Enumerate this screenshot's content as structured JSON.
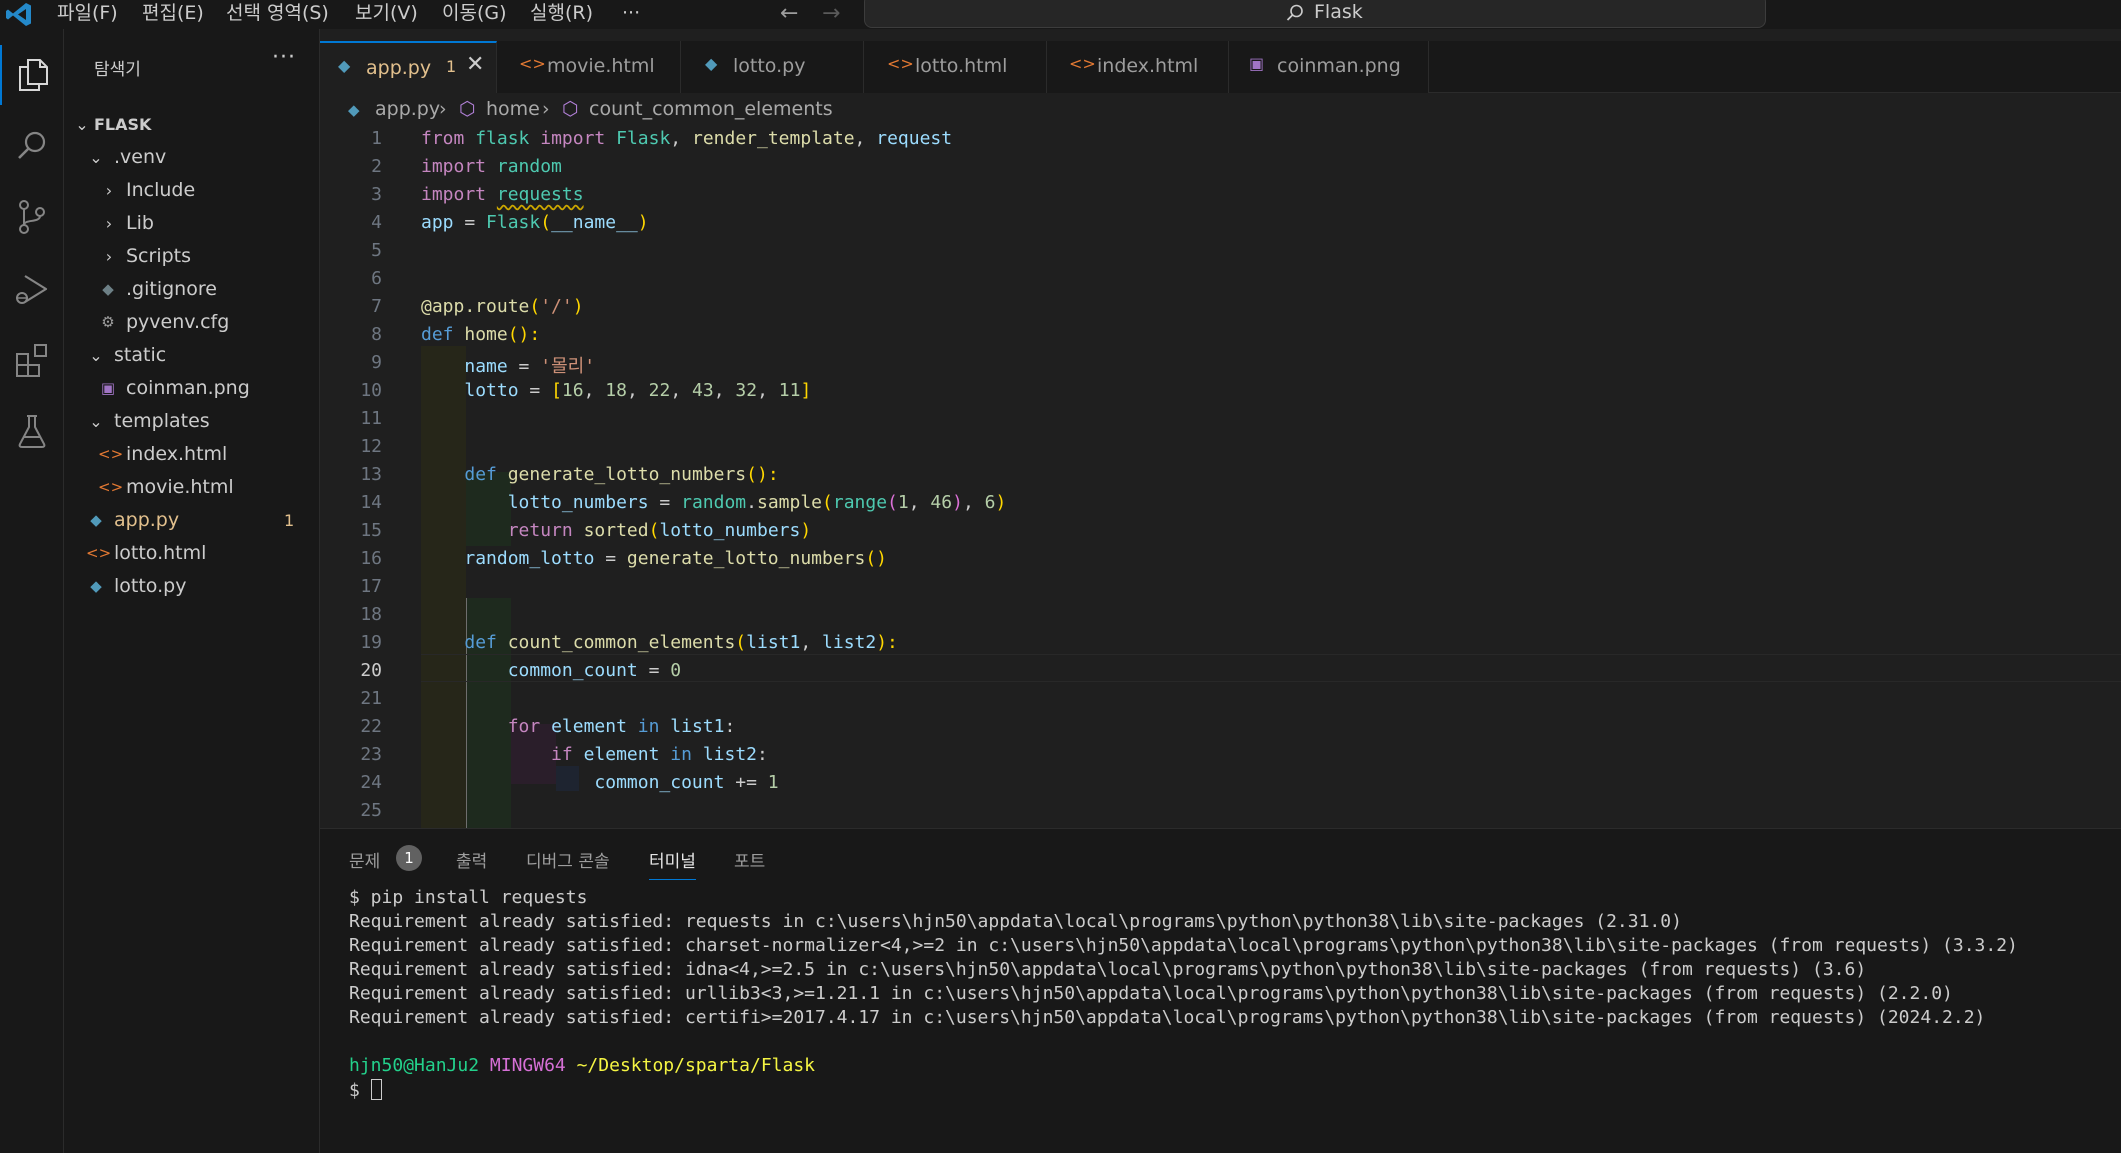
{
  "titlebar": {
    "menu": [
      "파일(F)",
      "편집(E)",
      "선택 영역(S)",
      "보기(V)",
      "이동(G)",
      "실행(R)",
      "···"
    ],
    "search_text": "Flask"
  },
  "sidebar": {
    "title": "탐색기",
    "more": "···",
    "root": "FLASK",
    "items": [
      {
        "label": ".venv"
      },
      {
        "label": "Include"
      },
      {
        "label": "Lib"
      },
      {
        "label": "Scripts"
      },
      {
        "label": ".gitignore"
      },
      {
        "label": "pyvenv.cfg"
      },
      {
        "label": "static"
      },
      {
        "label": "coinman.png"
      },
      {
        "label": "templates"
      },
      {
        "label": "index.html"
      },
      {
        "label": "movie.html"
      },
      {
        "label": "app.py",
        "badge": "1"
      },
      {
        "label": "lotto.html"
      },
      {
        "label": "lotto.py"
      }
    ]
  },
  "tabs": [
    {
      "label": "app.py",
      "badge": "1",
      "close": "✕"
    },
    {
      "label": "movie.html"
    },
    {
      "label": "lotto.py"
    },
    {
      "label": "lotto.html"
    },
    {
      "label": "index.html"
    },
    {
      "label": "coinman.png"
    }
  ],
  "breadcrumb": [
    "app.py",
    "home",
    "count_common_elements"
  ],
  "editor": {
    "active_line": 20,
    "line_numbers": [
      "1",
      "2",
      "3",
      "4",
      "5",
      "6",
      "7",
      "8",
      "9",
      "10",
      "11",
      "12",
      "13",
      "14",
      "15",
      "16",
      "17",
      "18",
      "19",
      "20",
      "21",
      "22",
      "23",
      "24",
      "25"
    ],
    "lines": {
      "l1": {
        "a": "from",
        "b": "flask",
        "c": "import",
        "d": "Flask",
        "e": ", ",
        "f": "render_template",
        "g": ", ",
        "h": "request"
      },
      "l2": {
        "a": "import",
        "b": "random"
      },
      "l3": {
        "a": "import",
        "b": "requests"
      },
      "l4": {
        "a": "app",
        "b": " = ",
        "c": "Flask",
        "d": "(",
        "e": "__name__",
        "f": ")"
      },
      "l7": {
        "a": "@app.route",
        "b": "(",
        "c": "'/'",
        "d": ")"
      },
      "l8": {
        "a": "def",
        "b": "home",
        "c": "():"
      },
      "l9": {
        "a": "name",
        "b": " = ",
        "c": "'몰리'"
      },
      "l10": {
        "a": "lotto",
        "b": " = ",
        "c": "[",
        "d": "16",
        "e": ", ",
        "f": "18",
        "g": ", ",
        "h": "22",
        "i": ", ",
        "j": "43",
        "k": ", ",
        "m": "32",
        "n": ", ",
        "o": "11",
        "p": "]"
      },
      "l13": {
        "a": "def",
        "b": "generate_lotto_numbers",
        "c": "():"
      },
      "l14": {
        "a": "lotto_numbers",
        "b": " = ",
        "c": "random",
        "d": ".",
        "e": "sample",
        "f": "(",
        "g": "range",
        "h": "(",
        "i": "1",
        "j": ", ",
        "k": "46",
        "m": ")",
        "n": ", ",
        "o": "6",
        "p": ")"
      },
      "l15": {
        "a": "return",
        "b": "sorted",
        "c": "(",
        "d": "lotto_numbers",
        "e": ")"
      },
      "l16": {
        "a": "random_lotto",
        "b": " = ",
        "c": "generate_lotto_numbers",
        "d": "()"
      },
      "l19": {
        "a": "def",
        "b": "count_common_elements",
        "c": "(",
        "d": "list1",
        "e": ", ",
        "f": "list2",
        "g": "):"
      },
      "l20": {
        "a": "common_count",
        "b": " = ",
        "c": "0"
      },
      "l22": {
        "a": "for",
        "b": "element",
        "c": "in",
        "d": "list1",
        "e": ":"
      },
      "l23": {
        "a": "if",
        "b": "element",
        "c": "in",
        "d": "list2",
        "e": ":"
      },
      "l24": {
        "a": "common_count",
        "b": " += ",
        "c": "1"
      }
    }
  },
  "panel": {
    "tabs": [
      "문제",
      "출력",
      "디버그 콘솔",
      "터미널",
      "포트"
    ],
    "problems_count": "1",
    "terminal": {
      "cmd": "$ pip install requests",
      "out": [
        "Requirement already satisfied: requests in c:\\users\\hjn50\\appdata\\local\\programs\\python\\python38\\lib\\site-packages (2.31.0)",
        "Requirement already satisfied: charset-normalizer<4,>=2 in c:\\users\\hjn50\\appdata\\local\\programs\\python\\python38\\lib\\site-packages (from requests) (3.3.2)",
        "Requirement already satisfied: idna<4,>=2.5 in c:\\users\\hjn50\\appdata\\local\\programs\\python\\python38\\lib\\site-packages (from requests) (3.6)",
        "Requirement already satisfied: urllib3<3,>=1.21.1 in c:\\users\\hjn50\\appdata\\local\\programs\\python\\python38\\lib\\site-packages (from requests) (2.2.0)",
        "Requirement already satisfied: certifi>=2017.4.17 in c:\\users\\hjn50\\appdata\\local\\programs\\python\\python38\\lib\\site-packages (from requests) (2024.2.2)"
      ],
      "user_host": "hjn50@HanJu2",
      "shell": "MINGW64",
      "path": "~/Desktop/sparta/Flask",
      "prompt": "$"
    }
  },
  "colors": {
    "accent": "#0078d4",
    "modified": "#e2c08d",
    "python_icon": "#519aba",
    "html_icon": "#e37933",
    "image_icon": "#a074c4"
  },
  "icons": {
    "activity": [
      "files-icon",
      "search-icon",
      "source-control-icon",
      "run-debug-icon",
      "extensions-icon",
      "testing-icon"
    ],
    "python": "python-file-icon",
    "html": "html-file-icon",
    "image": "image-file-icon",
    "git": "git-file-icon",
    "gear": "gear-file-icon"
  }
}
